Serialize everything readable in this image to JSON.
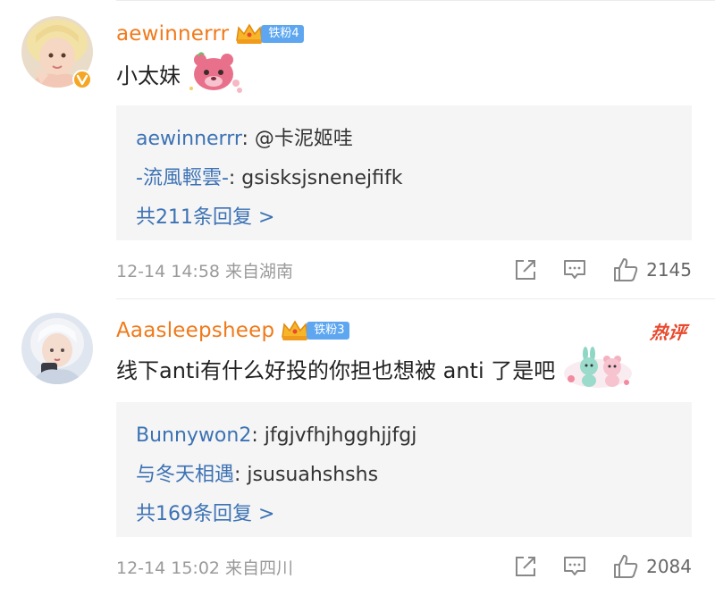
{
  "comments": [
    {
      "username": "aewinnerrr",
      "fan_badge": "铁粉4",
      "content": "小太妹",
      "replies": [
        {
          "name": "aewinnerrr",
          "text": ": @卡泥姬哇"
        },
        {
          "name": "-流風輕雲-",
          "text": ": gsisksjsnenejfifk"
        }
      ],
      "more_replies": "共211条回复 >",
      "time": "12-14 14:58 来自湖南",
      "likes": "2145",
      "icons": [
        "verified-icon",
        "crown-icon",
        "strawberry-bear-sticker"
      ]
    },
    {
      "username": "Aaasleepsheep",
      "fan_badge": "铁粉3",
      "hot_label": "热评",
      "content": "线下anti有什么好投的你担也想被 anti 了是吧",
      "replies": [
        {
          "name": "Bunnywon2",
          "text": ": jfgjvfhjhgghjjfgj"
        },
        {
          "name": "与冬天相遇",
          "text": ": jsusuahshshs"
        }
      ],
      "more_replies": "共169条回复 >",
      "time": "12-14 15:02 来自四川",
      "likes": "2084",
      "icons": [
        "crown-icon",
        "bunny-bear-sticker"
      ]
    }
  ],
  "colors": {
    "username": "#f07a1b",
    "link": "#3c72b4",
    "fan_badge": "#5ea7f0",
    "hot": "#e8482c",
    "reply_bg": "#f5f5f5"
  }
}
